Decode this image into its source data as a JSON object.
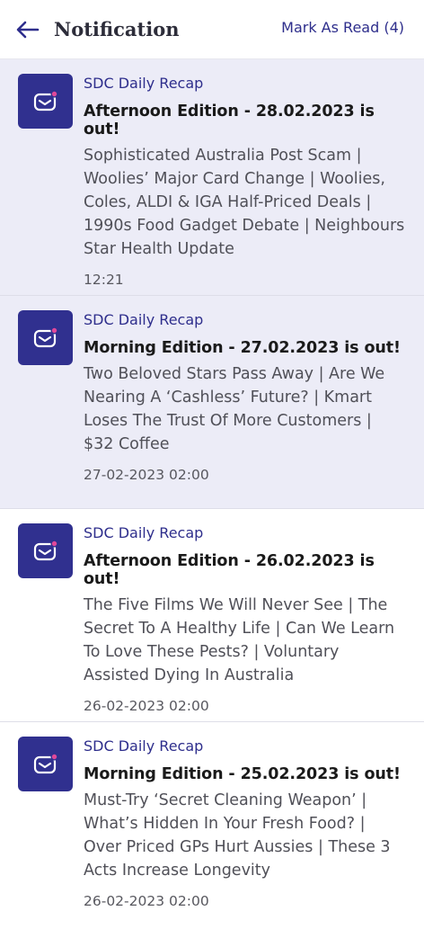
{
  "header": {
    "title": "Notification",
    "mark_read_label": "Mark As Read (4)",
    "back_icon": "arrow-left-icon"
  },
  "colors": {
    "accent": "#2e2e8c",
    "icon_bg": "#30308f",
    "unread_bg": "#ececf7",
    "dot": "#e0489a"
  },
  "notifications": [
    {
      "sender": "SDC Daily Recap",
      "headline": "Afternoon Edition - 28.02.2023 is out!",
      "body": "Sophisticated Australia Post Scam | Woolies’ Major Card Change | Woolies, Coles, ALDI & IGA Half-Priced Deals | 1990s Food Gadget Debate | Neighbours Star Health Update",
      "time": "12:21",
      "unread": true
    },
    {
      "sender": "SDC Daily Recap",
      "headline": "Morning Edition - 27.02.2023 is out!",
      "body": "Two Beloved Stars Pass Away | Are We Nearing A ‘Cashless’ Future? | Kmart Loses The Trust Of More Customers | $32 Coffee",
      "time": "27-02-2023 02:00",
      "unread": true
    },
    {
      "sender": "SDC Daily Recap",
      "headline": "Afternoon Edition - 26.02.2023 is out!",
      "body": "The Five Films We Will Never See | The Secret To A Healthy Life | Can We Learn To Love These Pests? | Voluntary Assisted Dying In Australia",
      "time": "26-02-2023 02:00",
      "unread": false
    },
    {
      "sender": "SDC Daily Recap",
      "headline": "Morning Edition - 25.02.2023 is out!",
      "body": "Must-Try ‘Secret Cleaning Weapon’ | What’s Hidden In Your Fresh Food? | Over Priced GPs Hurt Aussies | These 3 Acts Increase Longevity",
      "time": "26-02-2023 02:00",
      "unread": false
    }
  ]
}
